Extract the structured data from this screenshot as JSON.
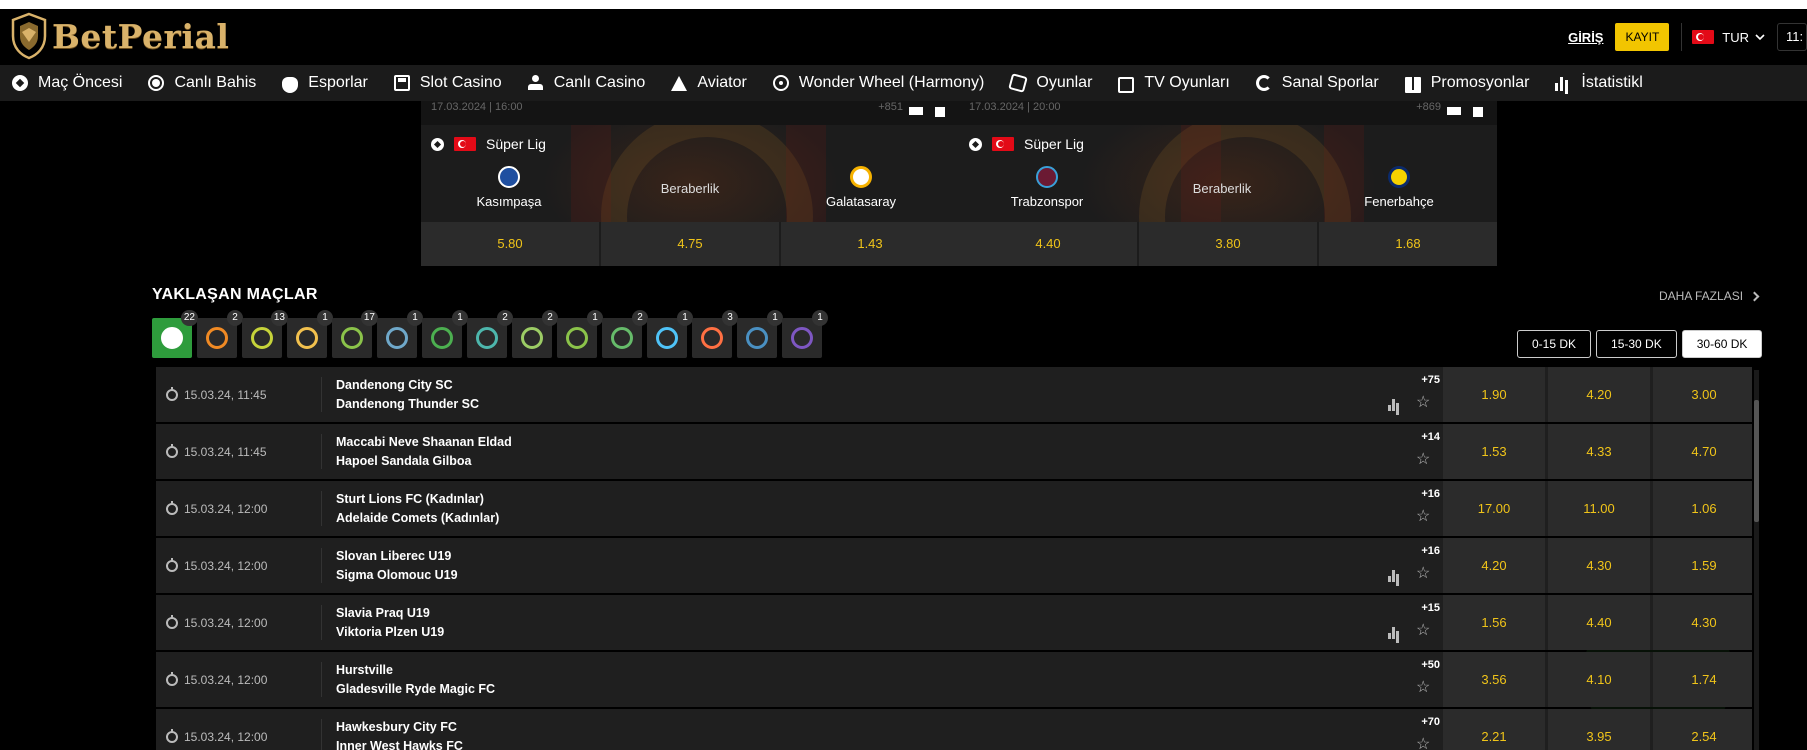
{
  "header": {
    "brand": "BetPerial",
    "login": "GİRİŞ",
    "register": "KAYIT",
    "language": "TUR",
    "clock": "11:"
  },
  "nav": [
    {
      "label": "Maç Öncesi",
      "icon": "soccer-ball-icon"
    },
    {
      "label": "Canlı Bahis",
      "icon": "live-icon"
    },
    {
      "label": "Esporlar",
      "icon": "gamepad-icon"
    },
    {
      "label": "Slot Casino",
      "icon": "slot-machine-icon"
    },
    {
      "label": "Canlı Casino",
      "icon": "dealer-icon"
    },
    {
      "label": "Aviator",
      "icon": "plane-icon"
    },
    {
      "label": "Wonder Wheel (Harmony)",
      "icon": "wheel-icon"
    },
    {
      "label": "Oyunlar",
      "icon": "dice-icon"
    },
    {
      "label": "TV Oyunları",
      "icon": "tv-icon"
    },
    {
      "label": "Sanal Sporlar",
      "icon": "virtual-sports-icon"
    },
    {
      "label": "Promosyonlar",
      "icon": "gift-icon"
    },
    {
      "label": "İstatistikl",
      "icon": "stats-icon"
    }
  ],
  "featured": [
    {
      "date": "17.03.2024 | 16:00",
      "code": "+851",
      "league": "Süper Lig",
      "home": "Kasımpaşa",
      "draw": "Beraberlik",
      "away": "Galatasaray",
      "odds": [
        "5.80",
        "4.75",
        "1.43"
      ]
    },
    {
      "date": "17.03.2024 | 20:00",
      "code": "+869",
      "league": "Süper Lig",
      "home": "Trabzonspor",
      "draw": "Beraberlik",
      "away": "Fenerbahçe",
      "odds": [
        "4.40",
        "3.80",
        "1.68"
      ]
    }
  ],
  "upcoming": {
    "title": "YAKLAŞAN MAÇLAR",
    "more": "DAHA FAZLASI",
    "sports": [
      {
        "icon": "soccer-icon",
        "count": "22",
        "color": "#ffffff"
      },
      {
        "icon": "basketball-icon",
        "count": "2",
        "color": "#f08a24"
      },
      {
        "icon": "tennis-icon",
        "count": "13",
        "color": "#c6d33a"
      },
      {
        "icon": "volleyball-icon",
        "count": "1",
        "color": "#f2c14e"
      },
      {
        "icon": "table-tennis-icon",
        "count": "17",
        "color": "#8bc34a"
      },
      {
        "icon": "futsal-icon",
        "count": "1",
        "color": "#6fa8c9"
      },
      {
        "icon": "rugby-icon",
        "count": "1",
        "color": "#4caf50"
      },
      {
        "icon": "baseball-icon",
        "count": "2",
        "color": "#4db6ac"
      },
      {
        "icon": "badminton-icon",
        "count": "2",
        "color": "#9ccc65"
      },
      {
        "icon": "american-football-icon",
        "count": "1",
        "color": "#8bc34a"
      },
      {
        "icon": "hockey-icon",
        "count": "2",
        "color": "#66bb6a"
      },
      {
        "icon": "water-polo-icon",
        "count": "1",
        "color": "#4fc3f7"
      },
      {
        "icon": "counter-strike-icon",
        "count": "3",
        "color": "#ff7043"
      },
      {
        "icon": "league-of-legends-icon",
        "count": "1",
        "color": "#4a90c2"
      },
      {
        "icon": "dota-icon",
        "count": "1",
        "color": "#7e57c2"
      }
    ],
    "time_filters": [
      "0-15 DK",
      "15-30 DK",
      "30-60 DK"
    ],
    "active_filter": "30-60 DK",
    "matches": [
      {
        "time": "15.03.24, 11:45",
        "home": "Dandenong City SC",
        "away": "Dandenong Thunder SC",
        "more": "+75",
        "stats": true,
        "odds": [
          "1.90",
          "4.20",
          "3.00"
        ]
      },
      {
        "time": "15.03.24, 11:45",
        "home": "Maccabi Neve Shaanan Eldad",
        "away": "Hapoel Sandala Gilboa",
        "more": "+14",
        "stats": false,
        "odds": [
          "1.53",
          "4.33",
          "4.70"
        ]
      },
      {
        "time": "15.03.24, 12:00",
        "home": "Sturt Lions FC (Kadınlar)",
        "away": "Adelaide Comets (Kadınlar)",
        "more": "+16",
        "stats": false,
        "odds": [
          "17.00",
          "11.00",
          "1.06"
        ]
      },
      {
        "time": "15.03.24, 12:00",
        "home": "Slovan Liberec U19",
        "away": "Sigma Olomouc U19",
        "more": "+16",
        "stats": true,
        "odds": [
          "4.20",
          "4.30",
          "1.59"
        ]
      },
      {
        "time": "15.03.24, 12:00",
        "home": "Slavia Praq U19",
        "away": "Viktoria Plzen U19",
        "more": "+15",
        "stats": true,
        "odds": [
          "1.56",
          "4.40",
          "4.30"
        ]
      },
      {
        "time": "15.03.24, 12:00",
        "home": "Hurstville",
        "away": "Gladesville Ryde Magic FC",
        "more": "+50",
        "stats": false,
        "odds": [
          "3.56",
          "4.10",
          "1.74"
        ]
      },
      {
        "time": "15.03.24, 12:00",
        "home": "Hawkesbury City FC",
        "away": "Inner West Hawks FC",
        "more": "+70",
        "stats": false,
        "odds": [
          "2.21",
          "3.95",
          "2.54"
        ]
      }
    ]
  }
}
